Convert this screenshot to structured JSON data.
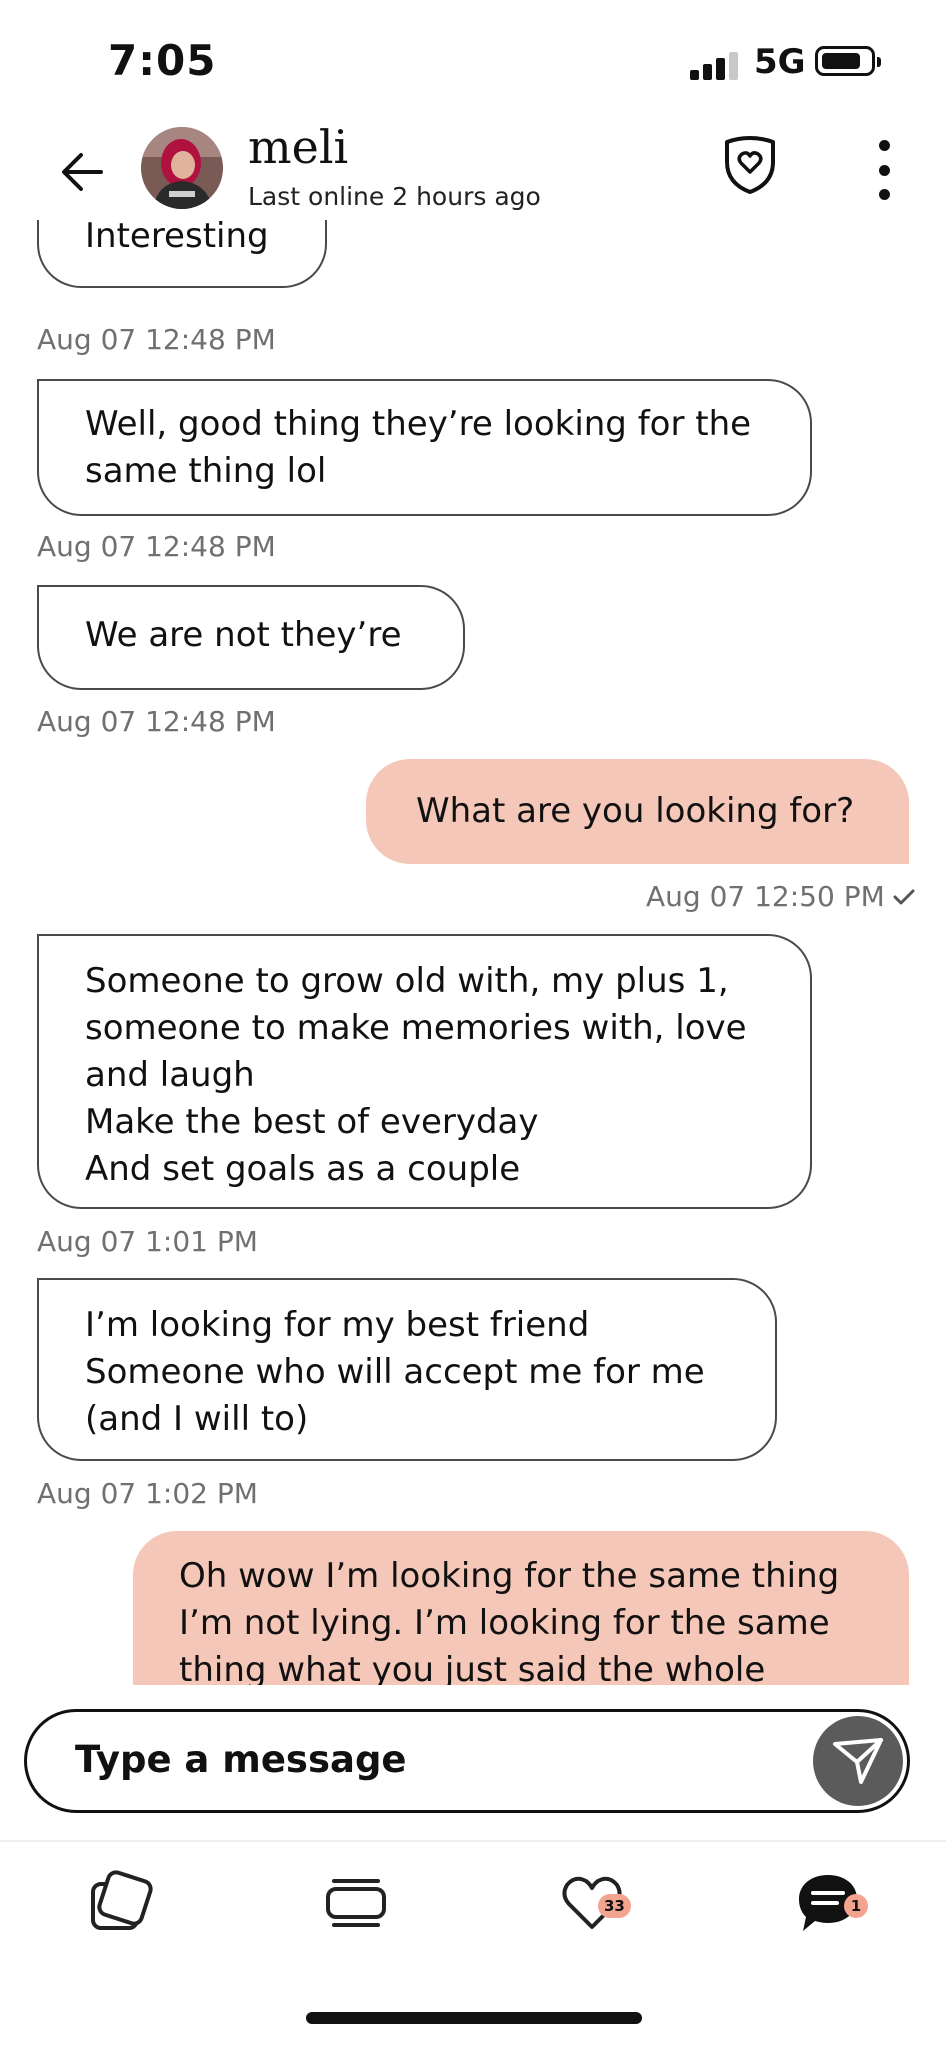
{
  "status_bar": {
    "time": "7:05",
    "network": "5G",
    "icons": [
      "signal-icon",
      "battery-icon"
    ]
  },
  "header": {
    "contact_name": "meli",
    "contact_status": "Last online 2 hours ago",
    "icons": [
      "back-arrow-icon",
      "avatar",
      "shield-heart-icon",
      "more-vertical-icon"
    ]
  },
  "messages": [
    {
      "direction": "received",
      "text": "Interesting",
      "time": "Aug 07 12:48 PM"
    },
    {
      "direction": "received",
      "text": "Well, good thing they’re looking for the\nsame thing lol",
      "time": "Aug 07 12:48 PM"
    },
    {
      "direction": "received",
      "text": "We are not they’re",
      "time": "Aug 07 12:48 PM"
    },
    {
      "direction": "sent",
      "text": "What are you looking for?",
      "time": "Aug 07 12:50 PM",
      "status_icon": "checkmark-icon"
    },
    {
      "direction": "received",
      "text": "Someone to grow old with, my plus 1,\nsomeone to make memories with, love\nand laugh\nMake the best of everyday\nAnd set goals as a couple",
      "time": "Aug 07 1:01 PM"
    },
    {
      "direction": "received",
      "text": "I’m looking for my best friend\nSomeone who will accept me for me\n(and I will to)",
      "time": "Aug 07 1:02 PM"
    },
    {
      "direction": "sent",
      "text": "Oh wow I’m looking for the same thing\nI’m not lying. I’m looking for the same\nthing what you just said the whole"
    }
  ],
  "composer": {
    "placeholder": "Type a message",
    "value": "",
    "send_icon": "send-icon"
  },
  "tab_bar": {
    "tabs": [
      {
        "name": "discover",
        "icon": "cards-icon"
      },
      {
        "name": "stack",
        "icon": "stack-icon"
      },
      {
        "name": "likes",
        "icon": "heart-icon",
        "badge": "33"
      },
      {
        "name": "messages",
        "icon": "chat-icon",
        "badge": "1",
        "active": true
      }
    ]
  },
  "colors": {
    "sent_bubble": "#f5c7b8",
    "received_border": "#4a4a4a",
    "timestamp": "#707070",
    "badge": "#f2a48f",
    "send_button": "#5b5b5b"
  }
}
